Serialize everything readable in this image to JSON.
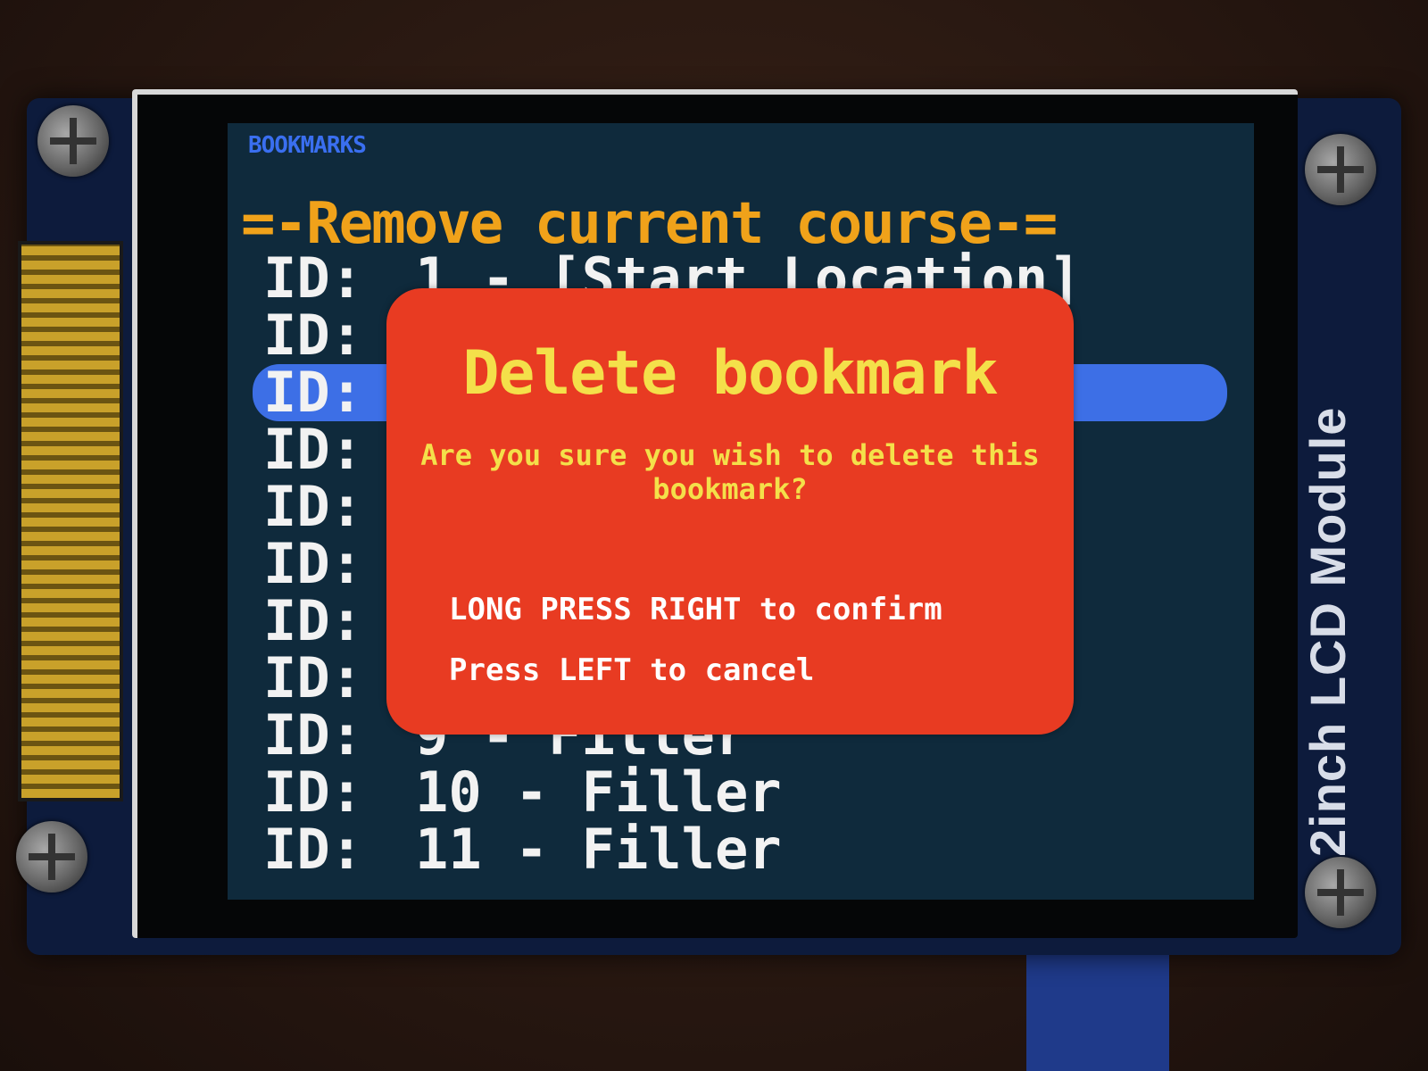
{
  "app_title": "BOOKMARKS",
  "subheader": "=-Remove current course-=",
  "bookmarks": [
    {
      "label": "ID:",
      "text": "1 - [Start Location]"
    },
    {
      "label": "ID:",
      "text": ""
    },
    {
      "label": "ID:",
      "text": ""
    },
    {
      "label": "ID:",
      "text": ""
    },
    {
      "label": "ID:",
      "text": ""
    },
    {
      "label": "ID:",
      "text": ""
    },
    {
      "label": "ID:",
      "text": ""
    },
    {
      "label": "ID:",
      "text": ""
    },
    {
      "label": "ID:",
      "text": "9 - Filler"
    },
    {
      "label": "ID:",
      "text": "10 - Filler"
    },
    {
      "label": "ID:",
      "text": "11 - Filler"
    }
  ],
  "dialog": {
    "title": "Delete bookmark",
    "message": "Are you sure you wish to delete this bookmark?",
    "confirm_hint": "LONG PRESS RIGHT to confirm",
    "cancel_hint": "Press LEFT to cancel"
  },
  "hardware": {
    "module_label": "2inch LCD Module"
  },
  "colors": {
    "screen_bg": "#0f2a3c",
    "title": "#3a6ff0",
    "subheader": "#f0a21a",
    "selection": "#3d6fe6",
    "dialog_bg": "#e83b22",
    "dialog_title": "#f4e04a"
  }
}
